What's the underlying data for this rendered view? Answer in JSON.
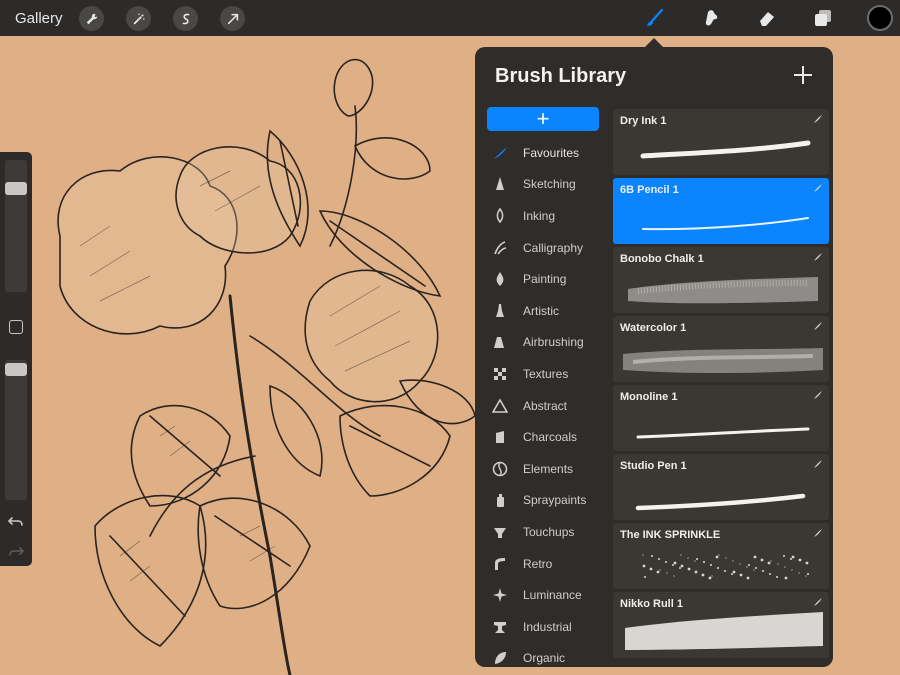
{
  "toolbar": {
    "gallery_label": "Gallery",
    "left_tools": [
      "wrench-icon",
      "magic-wand-icon",
      "selection-icon",
      "transform-arrow-icon"
    ],
    "right_tools": [
      "brush-icon",
      "smudge-icon",
      "eraser-icon",
      "layers-icon"
    ],
    "active_tool": "brush-icon",
    "active_color": "#0a84ff",
    "current_color": "#000000"
  },
  "library": {
    "title": "Brush Library",
    "sets": [
      {
        "label": "Favourites",
        "icon": "favourites-icon",
        "active": true
      },
      {
        "label": "Sketching",
        "icon": "sketching-icon"
      },
      {
        "label": "Inking",
        "icon": "inking-icon"
      },
      {
        "label": "Calligraphy",
        "icon": "calligraphy-icon"
      },
      {
        "label": "Painting",
        "icon": "painting-icon"
      },
      {
        "label": "Artistic",
        "icon": "artistic-icon"
      },
      {
        "label": "Airbrushing",
        "icon": "airbrushing-icon"
      },
      {
        "label": "Textures",
        "icon": "textures-icon"
      },
      {
        "label": "Abstract",
        "icon": "abstract-icon"
      },
      {
        "label": "Charcoals",
        "icon": "charcoals-icon"
      },
      {
        "label": "Elements",
        "icon": "elements-icon"
      },
      {
        "label": "Spraypaints",
        "icon": "spraypaints-icon"
      },
      {
        "label": "Touchups",
        "icon": "touchups-icon"
      },
      {
        "label": "Retro",
        "icon": "retro-icon"
      },
      {
        "label": "Luminance",
        "icon": "luminance-icon"
      },
      {
        "label": "Industrial",
        "icon": "industrial-icon"
      },
      {
        "label": "Organic",
        "icon": "organic-icon"
      }
    ],
    "brushes": [
      {
        "name": "Dry Ink 1",
        "style": "ink"
      },
      {
        "name": "6B Pencil 1",
        "style": "pencil",
        "selected": true
      },
      {
        "name": "Bonobo Chalk 1",
        "style": "chalk"
      },
      {
        "name": "Watercolor 1",
        "style": "watercolor"
      },
      {
        "name": "Monoline 1",
        "style": "monoline"
      },
      {
        "name": "Studio Pen 1",
        "style": "pen"
      },
      {
        "name": "The INK SPRINKLE",
        "style": "sprinkle"
      },
      {
        "name": "Nikko Rull 1",
        "style": "rull"
      }
    ]
  },
  "colors": {
    "canvas": "#DFAF86",
    "panel": "#2f2c29",
    "accent": "#0a84ff",
    "ink": "#2a2420"
  }
}
